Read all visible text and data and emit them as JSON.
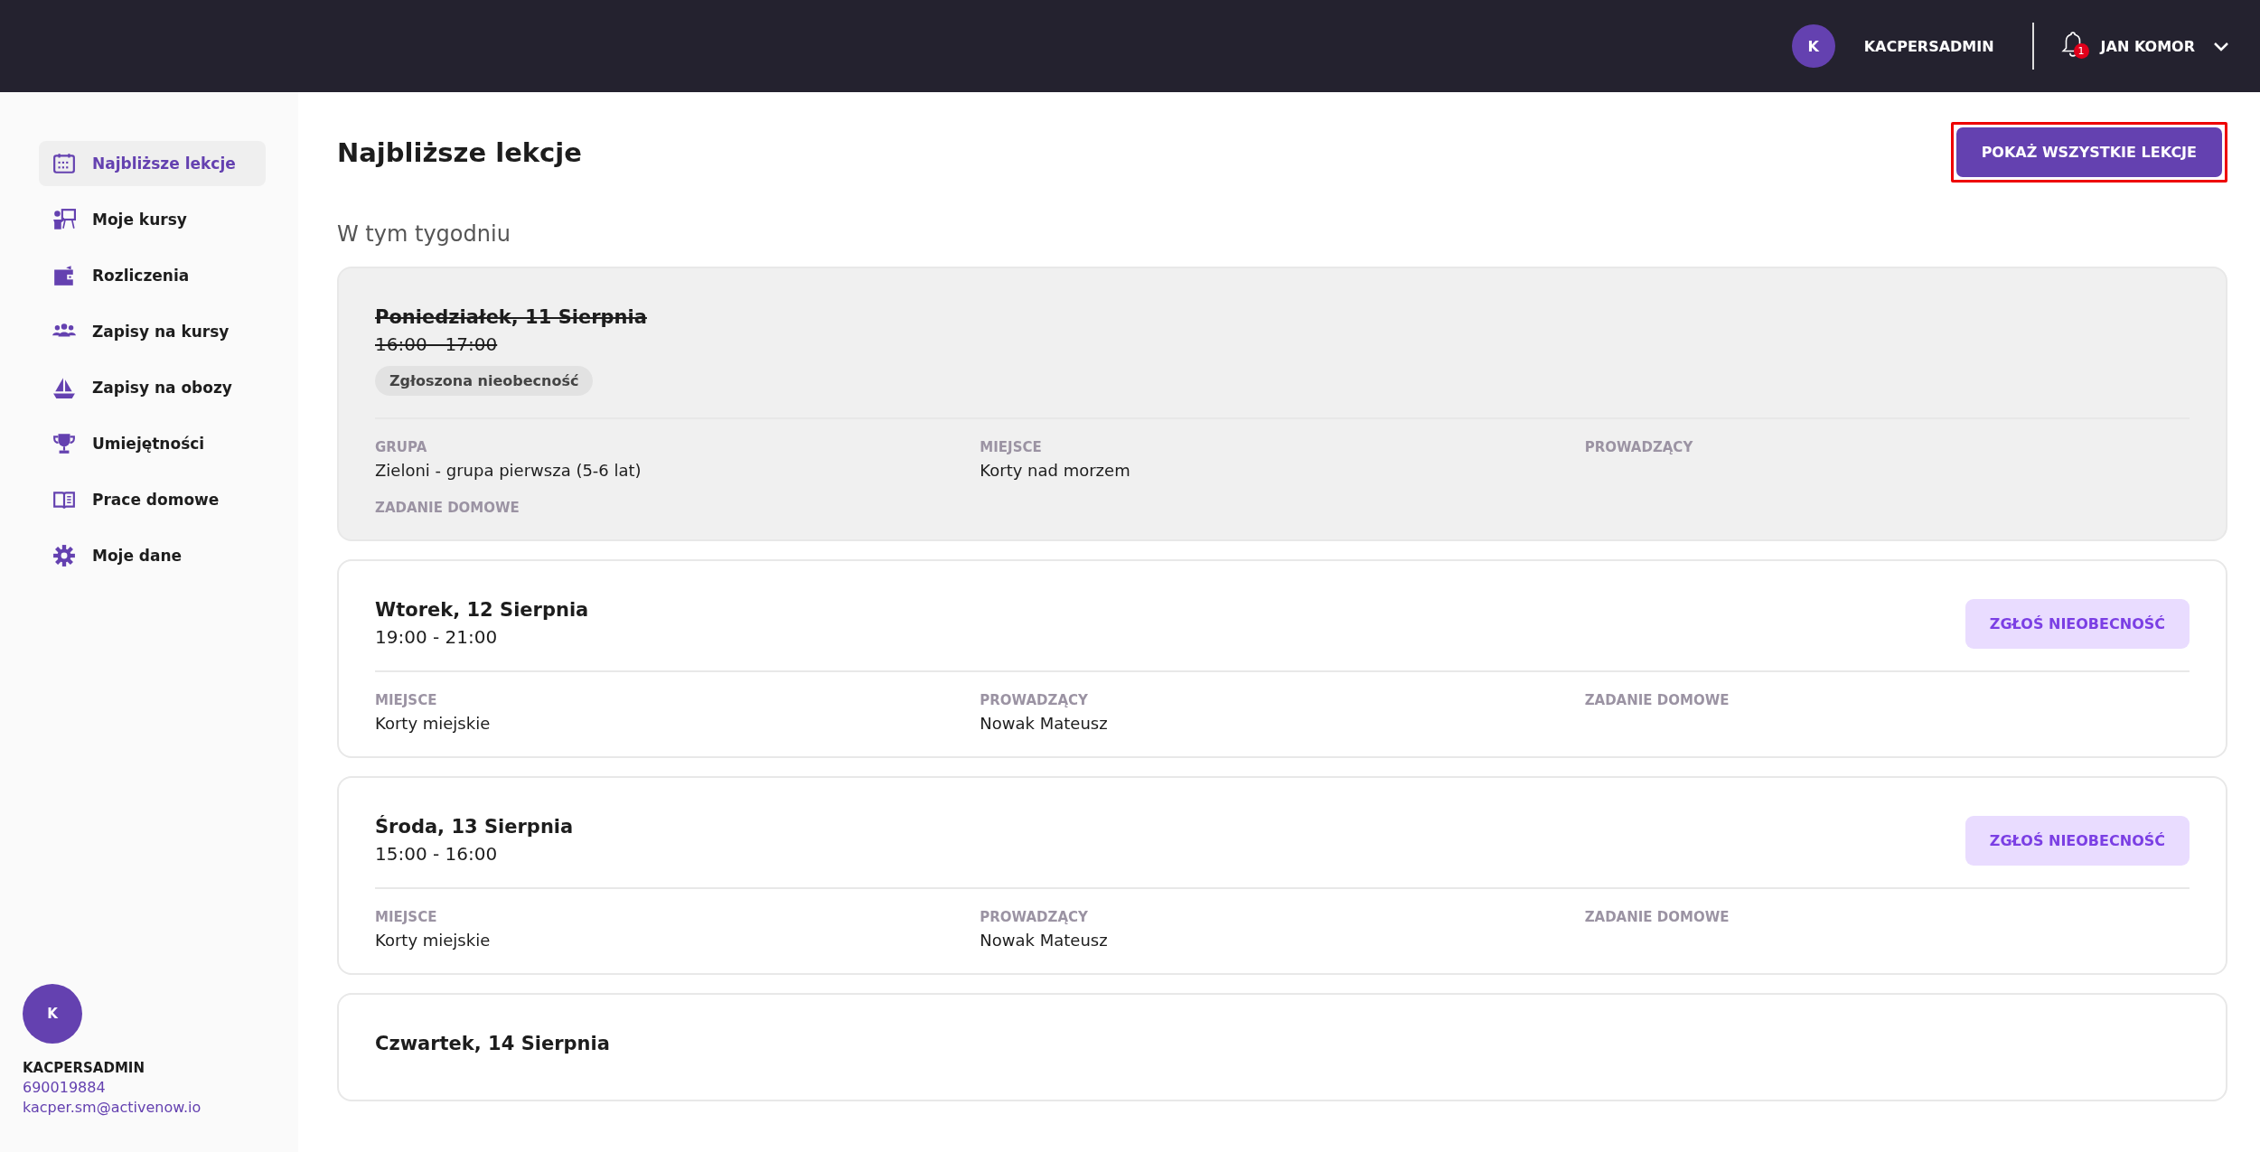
{
  "topbar": {
    "account_avatar": "K",
    "account_name": "KACPERSADMIN",
    "notifications_count": "1",
    "user_name": "JAN KOMOR"
  },
  "sidebar": {
    "items": [
      {
        "label": "Najbliższe lekcje",
        "selected": true
      },
      {
        "label": "Moje kursy",
        "selected": false
      },
      {
        "label": "Rozliczenia",
        "selected": false
      },
      {
        "label": "Zapisy na kursy",
        "selected": false
      },
      {
        "label": "Zapisy na obozy",
        "selected": false
      },
      {
        "label": "Umiejętności",
        "selected": false
      },
      {
        "label": "Prace domowe",
        "selected": false
      },
      {
        "label": "Moje dane",
        "selected": false
      }
    ],
    "profile": {
      "avatar": "K",
      "name": "KACPERSADMIN",
      "phone": "690019884",
      "email": "kacper.sm@activenow.io"
    }
  },
  "page": {
    "title": "Najbliższe lekcje",
    "show_all_button": "POKAŻ WSZYSTKIE LEKCJE",
    "section": "W tym tygodniu"
  },
  "lessons": [
    {
      "date": "Poniedziałek, 11 Sierpnia",
      "time": "16:00 - 17:00",
      "cancelled": true,
      "badge": "Zgłoszona nieobecność",
      "fields": [
        {
          "label": "GRUPA",
          "value": "Zieloni - grupa pierwsza (5-6 lat)"
        },
        {
          "label": "MIEJSCE",
          "value": "Korty nad morzem"
        },
        {
          "label": "PROWADZĄCY"
        },
        {
          "label": "ZADANIE DOMOWE"
        }
      ]
    },
    {
      "date": "Wtorek, 12 Sierpnia",
      "time": "19:00 - 21:00",
      "cancelled": false,
      "action": "ZGŁOŚ NIEOBECNOŚĆ",
      "fields": [
        {
          "label": "MIEJSCE",
          "value": "Korty miejskie"
        },
        {
          "label": "PROWADZĄCY",
          "value": "Nowak Mateusz"
        },
        {
          "label": "ZADANIE DOMOWE"
        }
      ]
    },
    {
      "date": "Środa, 13 Sierpnia",
      "time": "15:00 - 16:00",
      "cancelled": false,
      "action": "ZGŁOŚ NIEOBECNOŚĆ",
      "fields": [
        {
          "label": "MIEJSCE",
          "value": "Korty miejskie"
        },
        {
          "label": "PROWADZĄCY",
          "value": "Nowak Mateusz"
        },
        {
          "label": "ZADANIE DOMOWE"
        }
      ]
    },
    {
      "date": "Czwartek, 14 Sierpnia",
      "cancelled": false
    }
  ]
}
